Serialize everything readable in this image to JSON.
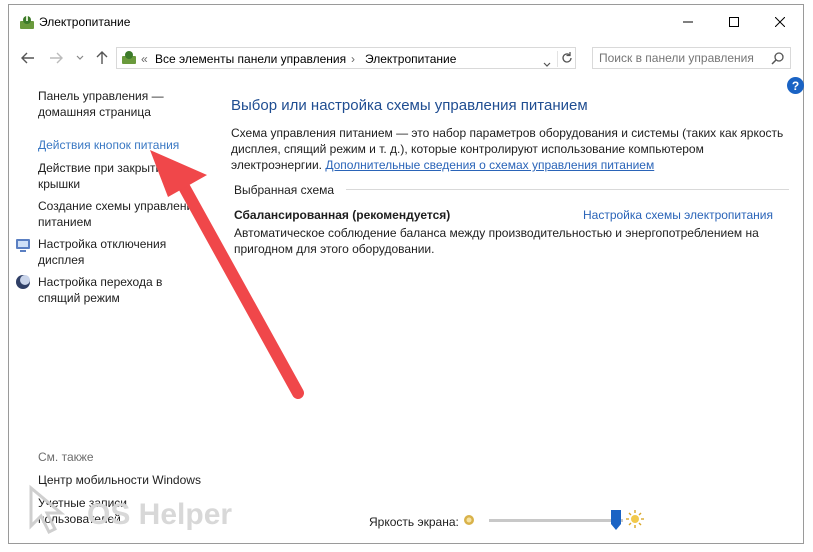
{
  "window": {
    "title": "Электропитание"
  },
  "breadcrumb": {
    "parent": "Все элементы панели управления",
    "current": "Электропитание",
    "overflow": "«",
    "sep": "›"
  },
  "search": {
    "placeholder": "Поиск в панели управления"
  },
  "help": {
    "glyph": "?"
  },
  "sidebar": {
    "home_line1": "Панель управления —",
    "home_line2": "домашняя страница",
    "items": [
      {
        "label": "Действия кнопок питания",
        "active": true
      },
      {
        "line1": "Действие при закрытии",
        "line2": "крышки"
      },
      {
        "line1": "Создание схемы управления",
        "line2": "питанием"
      },
      {
        "line1": "Настройка отключения",
        "line2": "дисплея",
        "icon": "display-icon"
      },
      {
        "line1": "Настройка перехода в",
        "line2": "спящий режим",
        "icon": "moon-icon"
      }
    ],
    "see_also": "См. также",
    "see_also_items": [
      {
        "label": "Центр мобильности Windows"
      },
      {
        "line1": "Учетные записи",
        "line2": "пользователей"
      }
    ]
  },
  "main": {
    "title": "Выбор или настройка схемы управления питанием",
    "desc_line1": "Схема управления питанием — это набор параметров оборудования и системы (таких как яркость",
    "desc_line2": "дисплея, спящий режим и т. д.), которые контролируют использование компьютером",
    "desc_line3": "электроэнергии.",
    "desc_link": "Дополнительные сведения о схемах управления питанием",
    "section_label": "Выбранная схема",
    "plan": {
      "name": "Сбалансированная (рекомендуется)",
      "link": "Настройка схемы электропитания",
      "desc_line1": "Автоматическое соблюдение баланса между производительностью и энергопотреблением на",
      "desc_line2": "пригодном для этого оборудовании."
    }
  },
  "footer": {
    "brightness_label": "Яркость экрана:",
    "brightness_level_pct": 95
  },
  "watermark": {
    "text": "OS Helper"
  },
  "colors": {
    "link": "#2a64b8",
    "title": "#1f4d91",
    "arrow": "#f0474a",
    "slider_thumb": "#1a63c4"
  }
}
